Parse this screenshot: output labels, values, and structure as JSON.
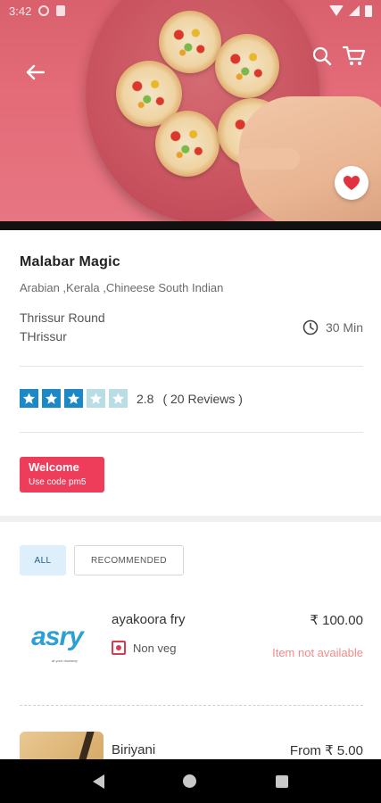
{
  "status_bar": {
    "time": "3:42"
  },
  "restaurant": {
    "name": "Malabar Magic",
    "cuisines": "Arabian ,Kerala ,Chineese  South Indian",
    "address_line1": "Thrissur Round",
    "address_line2": "THrissur",
    "delivery_time": "30 Min",
    "rating_value": "2.8",
    "rating_fill_stars": 3,
    "rating_total_stars": 5,
    "reviews": "( 20 Reviews )"
  },
  "promo": {
    "title": "Welcome",
    "subtitle": "Use code pm5"
  },
  "tabs": [
    {
      "label": "ALL",
      "active": true
    },
    {
      "label": "RECOMMENDED",
      "active": false
    }
  ],
  "menu_items": [
    {
      "name": "ayakoora fry",
      "price": "₹ 100.00",
      "type": "Non veg",
      "availability": "Item not available",
      "logo_text": "asry",
      "logo_subtext": "at your doorstep"
    },
    {
      "name": "Biriyani",
      "price": "From ₹ 5.00"
    }
  ],
  "colors": {
    "accent": "#1c88c6",
    "promo": "#ee3d5a",
    "unavailable": "#f08b8b",
    "nonveg": "#d73c4d"
  }
}
